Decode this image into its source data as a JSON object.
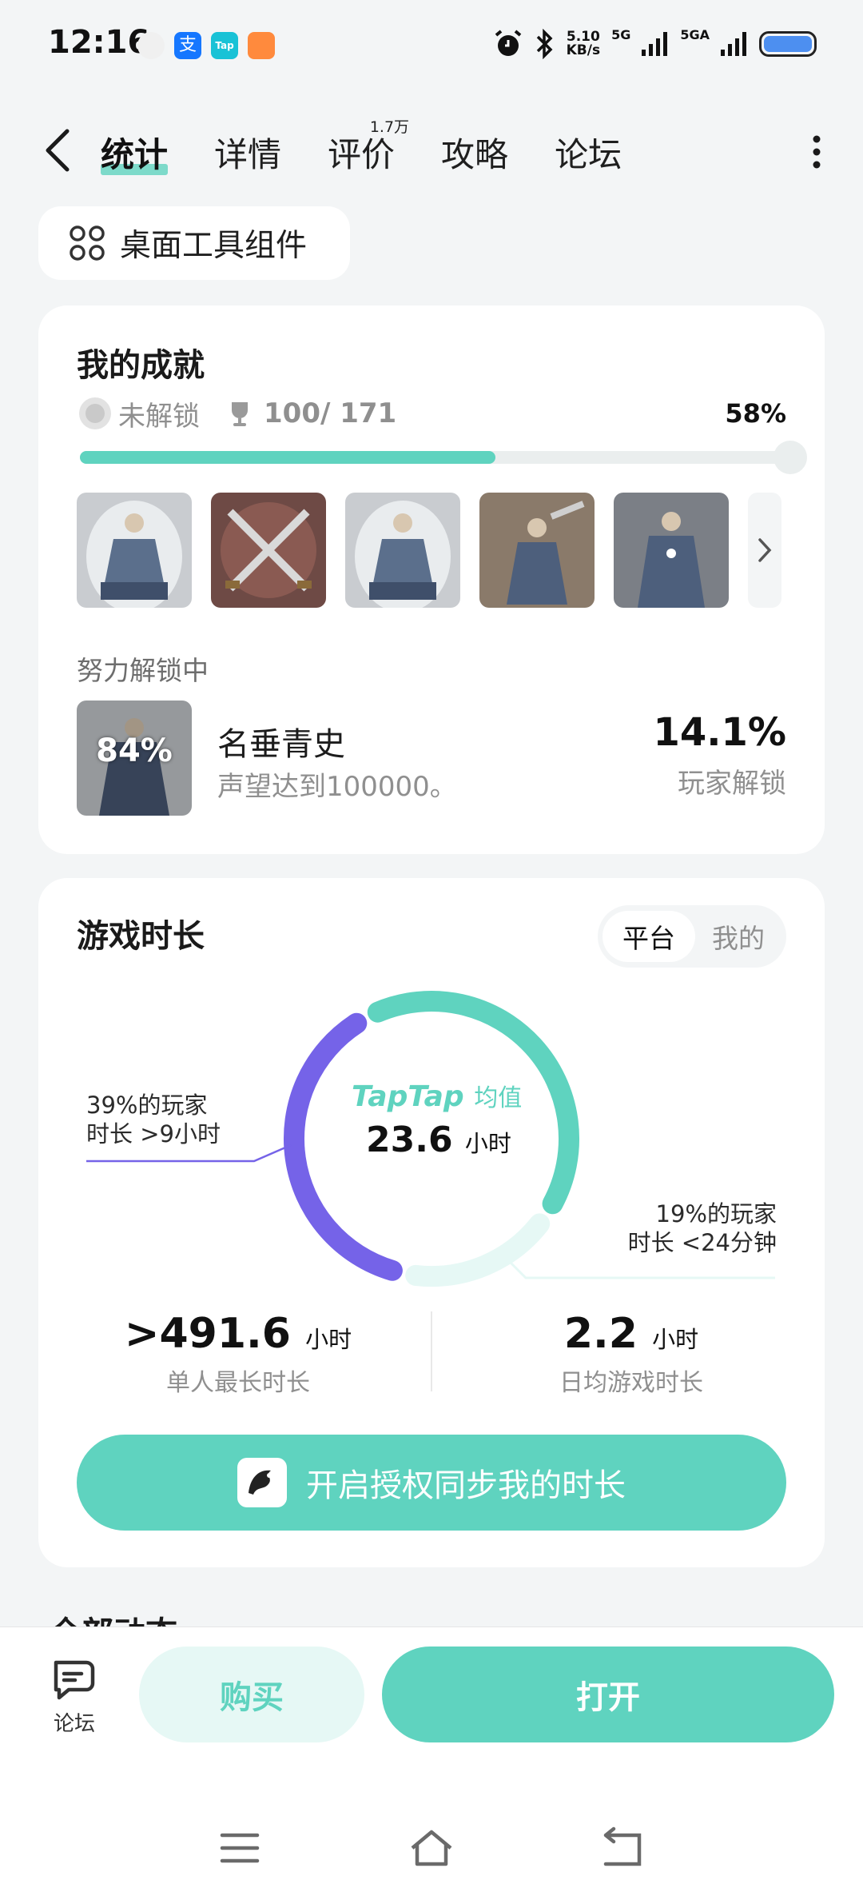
{
  "status_bar": {
    "time": "12:16",
    "net_speed_value": "5.10",
    "net_speed_unit": "KB/s",
    "network_1": "5G",
    "network_2": "5GA"
  },
  "nav": {
    "tabs": [
      "统计",
      "详情",
      "评价",
      "攻略",
      "论坛"
    ],
    "review_count": "1.7万"
  },
  "widget_button": "桌面工具组件",
  "achievements": {
    "title": "我的成就",
    "locked_label": "未解锁",
    "count": "100/ 171",
    "percent_text": "58%",
    "progress": 0.58
  },
  "effort": {
    "label": "努力解锁中",
    "thumb_percent": "84%",
    "name": "名垂青史",
    "description": "声望达到100000。",
    "rate": "14.1%",
    "rate_label": "玩家解锁"
  },
  "playtime": {
    "title": "游戏时长",
    "segment_on": "平台",
    "segment_off": "我的",
    "brand": "TapTap",
    "brand_sub": "均值",
    "average_value": "23.6",
    "average_unit": "小时",
    "annotation_left_line1": "39%的玩家",
    "annotation_left_line2": "时长 >9小时",
    "annotation_right_line1": "19%的玩家",
    "annotation_right_line2": "时长 <24分钟",
    "share_over_9h": 0.39,
    "share_under_24m": 0.19,
    "max_value": ">491.6",
    "max_unit": "小时",
    "max_label": "单人最长时长",
    "daily_value": "2.2",
    "daily_unit": "小时",
    "daily_label": "日均游戏时长",
    "sync_button": "开启授权同步我的时长"
  },
  "peek_text": "全部动态",
  "bottom": {
    "forum_label": "论坛",
    "buy_label": "购买",
    "open_label": "打开"
  },
  "colors": {
    "accent": "#5fd3bf",
    "accent_light": "#e6f8f5",
    "purple": "#7563e8"
  }
}
